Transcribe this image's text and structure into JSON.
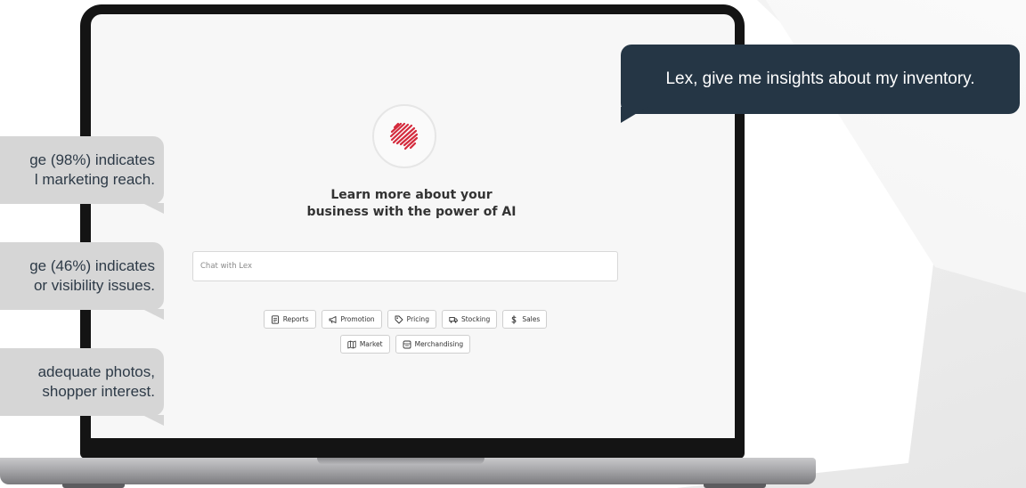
{
  "hero": {
    "headline_line1": "Learn more about your",
    "headline_line2": "business with the power of AI"
  },
  "chat": {
    "placeholder": "Chat with Lex"
  },
  "chips": [
    {
      "label": "Reports",
      "icon": "report-icon"
    },
    {
      "label": "Promotion",
      "icon": "megaphone-icon"
    },
    {
      "label": "Pricing",
      "icon": "tag-icon"
    },
    {
      "label": "Stocking",
      "icon": "truck-icon"
    },
    {
      "label": "Sales",
      "icon": "dollar-icon"
    },
    {
      "label": "Market",
      "icon": "map-icon"
    },
    {
      "label": "Merchandising",
      "icon": "storefront-icon"
    }
  ],
  "bubbles": {
    "user_prompt": "Lex, give me insights about my inventory.",
    "insight1_line1": "ge (98%) indicates",
    "insight1_line2": "l marketing reach.",
    "insight2_line1": "ge (46%) indicates",
    "insight2_line2": "or visibility issues.",
    "insight3_line1": "adequate photos,",
    "insight3_line2": "shopper interest."
  },
  "colors": {
    "user_bubble": "#253645",
    "insight_bubble": "#d6d6d6",
    "brand_accent": "#d42a3c",
    "screen_bg": "#f7f7f7"
  }
}
